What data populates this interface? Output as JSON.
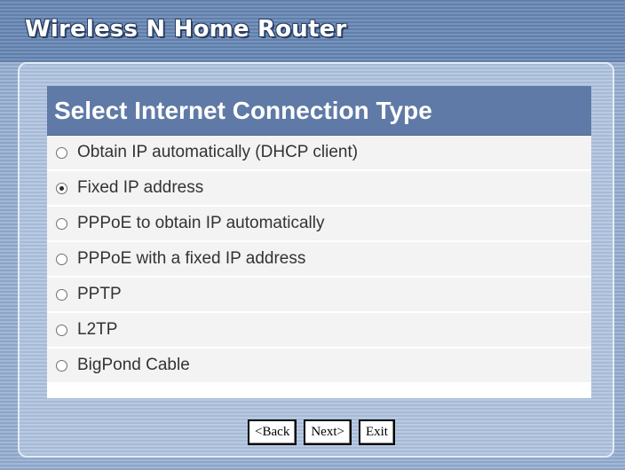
{
  "app": {
    "title": "Wireless N Home Router"
  },
  "section": {
    "title": "Select Internet Connection Type"
  },
  "options": [
    {
      "label": "Obtain IP automatically (DHCP client)",
      "selected": false
    },
    {
      "label": "Fixed IP address",
      "selected": true
    },
    {
      "label": "PPPoE to obtain IP automatically",
      "selected": false
    },
    {
      "label": "PPPoE with a fixed IP address",
      "selected": false
    },
    {
      "label": "PPTP",
      "selected": false
    },
    {
      "label": "L2TP",
      "selected": false
    },
    {
      "label": "BigPond Cable",
      "selected": false
    }
  ],
  "buttons": {
    "back": "<Back",
    "next": "Next>",
    "exit": "Exit"
  },
  "colors": {
    "header_bar": "#5f7aa6",
    "row_bg": "#f3f3f3",
    "panel_bg": "#b9cae2"
  }
}
